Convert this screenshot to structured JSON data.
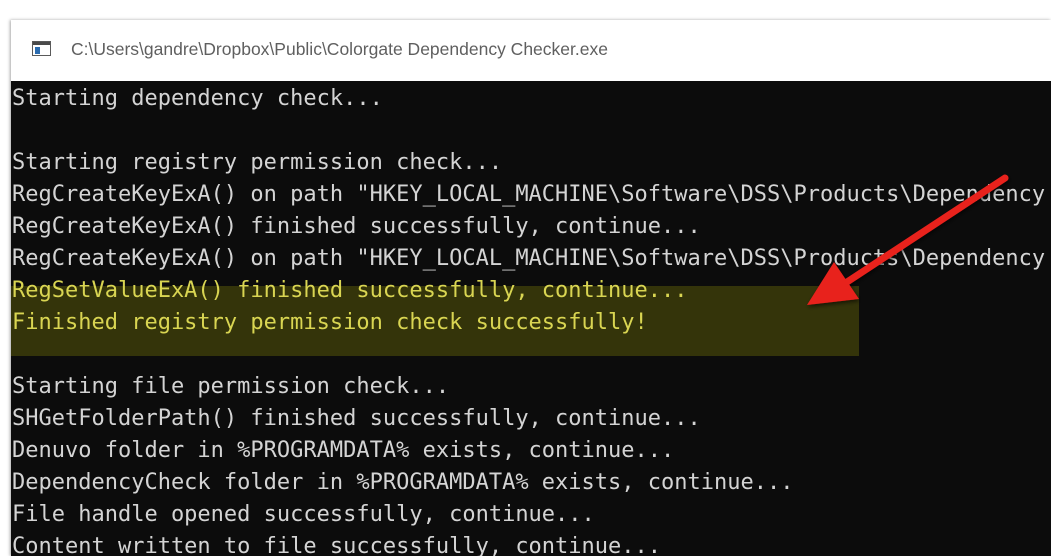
{
  "window": {
    "title": "C:\\Users\\gandre\\Dropbox\\Public\\Colorgate Dependency Checker.exe"
  },
  "console": {
    "lines": [
      "Starting dependency check...",
      "",
      "Starting registry permission check...",
      "RegCreateKeyExA() on path \"HKEY_LOCAL_MACHINE\\Software\\DSS\\Products\\Dependency Check\"",
      "RegCreateKeyExA() finished successfully, continue...",
      "RegCreateKeyExA() on path \"HKEY_LOCAL_MACHINE\\Software\\DSS\\Products\\Dependency Check\"",
      "RegSetValueExA() finished successfully, continue...",
      "Finished registry permission check successfully!",
      "",
      "Starting file permission check...",
      "SHGetFolderPath() finished successfully, continue...",
      "Denuvo folder in %PROGRAMDATA% exists, continue...",
      "DependencyCheck folder in %PROGRAMDATA% exists, continue...",
      "File handle opened successfully, continue...",
      "Content written to file successfully, continue..."
    ],
    "highlight_color": "#d9d552",
    "text_color": "#d4d4d4",
    "background_color": "#0c0c0c"
  },
  "annotation": {
    "arrow_color": "#e8201c"
  }
}
